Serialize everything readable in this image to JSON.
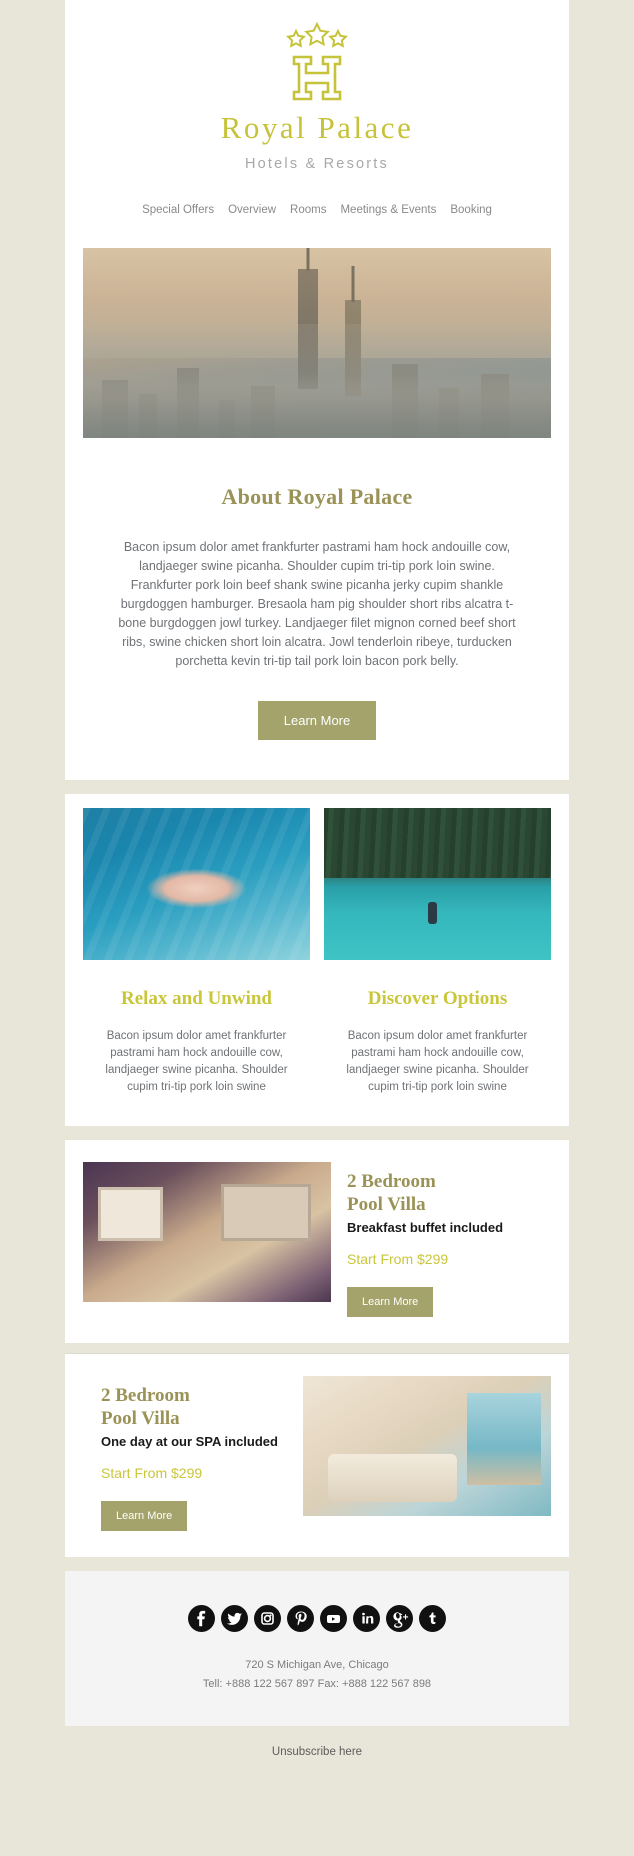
{
  "brand": {
    "name": "Royal Palace",
    "tagline": "Hotels & Resorts",
    "logo_icon": "three-stars-h-monogram",
    "gold": "#c6c33a",
    "olive": "#9a9256",
    "button_olive": "#a3a36b"
  },
  "nav": {
    "items": [
      {
        "label": "Special Offers"
      },
      {
        "label": "Overview"
      },
      {
        "label": "Rooms"
      },
      {
        "label": "Meetings & Events"
      },
      {
        "label": "Booking"
      }
    ]
  },
  "hero": {
    "alt": "city-skyline-tower-fog"
  },
  "about": {
    "heading": "About Royal Palace",
    "body": "Bacon ipsum dolor amet frankfurter pastrami ham hock andouille cow, landjaeger swine picanha. Shoulder cupim tri-tip pork loin swine. Frankfurter pork loin beef shank swine picanha jerky cupim shankle burgdoggen hamburger. Bresaola ham pig shoulder short ribs alcatra t-bone burgdoggen jowl turkey. Landjaeger filet mignon corned beef short ribs, swine chicken short loin alcatra. Jowl tenderloin ribeye, turducken porchetta kevin tri-tip tail pork loin bacon pork belly.",
    "button_label": "Learn More"
  },
  "features": {
    "left": {
      "image_alt": "woman-floating-in-pool",
      "heading": "Relax and Unwind",
      "body": "Bacon ipsum dolor amet frankfurter pastrami ham hock andouille cow, landjaeger swine picanha. Shoulder cupim tri-tip pork loin swine"
    },
    "right": {
      "image_alt": "person-standing-by-turquoise-lake",
      "heading": "Discover Options",
      "body": "Bacon ipsum dolor amet frankfurter pastrami ham hock andouille cow, landjaeger swine picanha. Shoulder cupim tri-tip pork loin swine"
    }
  },
  "rooms": [
    {
      "image_alt": "purple-toned-hotel-bedroom",
      "title": "2 Bedroom\nPool Villa",
      "title_line1": "2 Bedroom",
      "title_line2": "Pool Villa",
      "subtitle": "Breakfast buffet included",
      "price": "Start From $299",
      "button_label": "Learn More"
    },
    {
      "image_alt": "bright-villa-bedroom-with-sea-view",
      "title_line1": "2 Bedroom",
      "title_line2": "Pool Villa",
      "subtitle": "One day at our SPA included",
      "price": "Start From $299",
      "button_label": "Learn More"
    }
  ],
  "footer": {
    "socials": [
      {
        "name": "facebook"
      },
      {
        "name": "twitter"
      },
      {
        "name": "instagram"
      },
      {
        "name": "pinterest"
      },
      {
        "name": "youtube"
      },
      {
        "name": "linkedin"
      },
      {
        "name": "googleplus"
      },
      {
        "name": "tumblr"
      }
    ],
    "address": "720 S Michigan Ave, Chicago",
    "contact": "Tell: +888 122 567 897 Fax: +888 122 567 898",
    "unsubscribe": "Unsubscribe here"
  }
}
